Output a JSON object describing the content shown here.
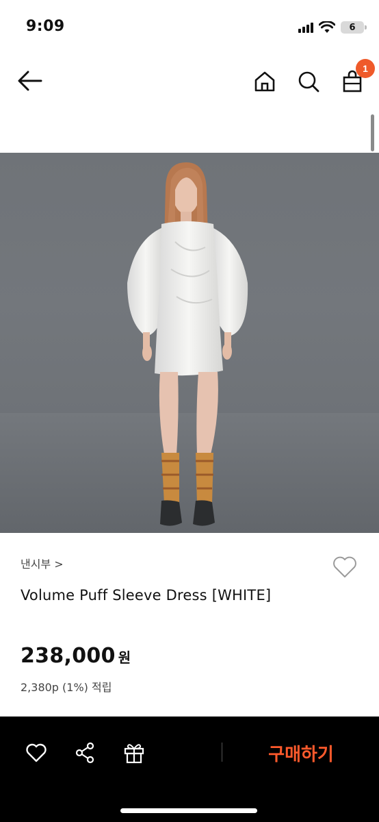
{
  "status_bar": {
    "time": "9:09",
    "battery_level": "6",
    "icons": [
      "cellular-signal-icon",
      "wifi-icon",
      "battery-icon"
    ]
  },
  "nav": {
    "icons": [
      "back-arrow-icon",
      "home-icon",
      "search-icon",
      "shopping-bag-icon"
    ],
    "cart_count": "1",
    "badge_color": "#ef5a2a"
  },
  "product": {
    "image_alt": "Model wearing white puff sleeve mini dress",
    "brand": "낸시부 >",
    "name": "Volume Puff Sleeve Dress [WHITE]",
    "price": "238,000",
    "currency": "원",
    "points": "2,380p (1%) 적립"
  },
  "bottom_bar": {
    "icons": [
      "heart-icon",
      "share-icon",
      "gift-icon"
    ],
    "buy_label": "구매하기",
    "buy_color": "#ff5a2c"
  }
}
